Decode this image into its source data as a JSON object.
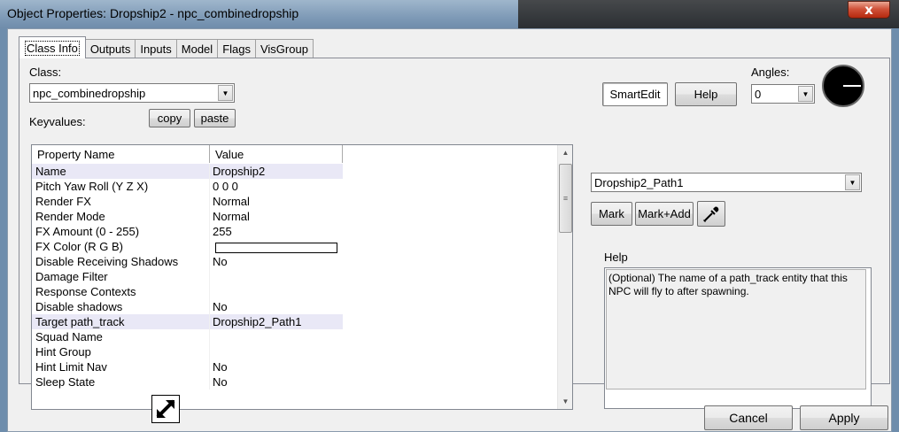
{
  "window": {
    "title": "Object Properties: Dropship2 - npc_combinedropship",
    "close_glyph": "x"
  },
  "tabs": [
    {
      "label": "Class Info",
      "active": true
    },
    {
      "label": "Outputs"
    },
    {
      "label": "Inputs"
    },
    {
      "label": "Model"
    },
    {
      "label": "Flags"
    },
    {
      "label": "VisGroup"
    }
  ],
  "class_info": {
    "class_label": "Class:",
    "class_value": "npc_combinedropship",
    "keyvalues_label": "Keyvalues:",
    "copy_label": "copy",
    "paste_label": "paste",
    "smartedit_label": "SmartEdit",
    "help_label": "Help",
    "angles_label": "Angles:",
    "angles_value": "0"
  },
  "grid": {
    "headers": [
      "Property Name",
      "Value"
    ],
    "rows": [
      {
        "name": "Name",
        "value": "Dropship2",
        "selected": true
      },
      {
        "name": "Pitch Yaw Roll (Y Z X)",
        "value": "0 0 0"
      },
      {
        "name": "Render FX",
        "value": "Normal"
      },
      {
        "name": "Render Mode",
        "value": "Normal"
      },
      {
        "name": "FX Amount (0 - 255)",
        "value": "255"
      },
      {
        "name": "FX Color (R G B)",
        "value": "",
        "color_swatch": "#ffffff"
      },
      {
        "name": "Disable Receiving Shadows",
        "value": "No"
      },
      {
        "name": "Damage Filter",
        "value": ""
      },
      {
        "name": "Response Contexts",
        "value": ""
      },
      {
        "name": "Disable shadows",
        "value": "No"
      },
      {
        "name": "Target path_track",
        "value": "Dropship2_Path1",
        "selected": true
      },
      {
        "name": "Squad Name",
        "value": ""
      },
      {
        "name": "Hint Group",
        "value": ""
      },
      {
        "name": "Hint Limit Nav",
        "value": "No"
      },
      {
        "name": "Sleep State",
        "value": "No"
      }
    ]
  },
  "value_editor": {
    "current_value": "Dropship2_Path1",
    "mark_label": "Mark",
    "mark_add_label": "Mark+Add",
    "picker_icon": "eyedropper-icon"
  },
  "help": {
    "label": "Help",
    "text": "(Optional) The name of a path_track entity that this NPC will fly to after spawning."
  },
  "footer": {
    "cancel_label": "Cancel",
    "apply_label": "Apply"
  },
  "colors": {
    "selected_row": "#e9e8f6",
    "close_button": "#c8452c"
  }
}
